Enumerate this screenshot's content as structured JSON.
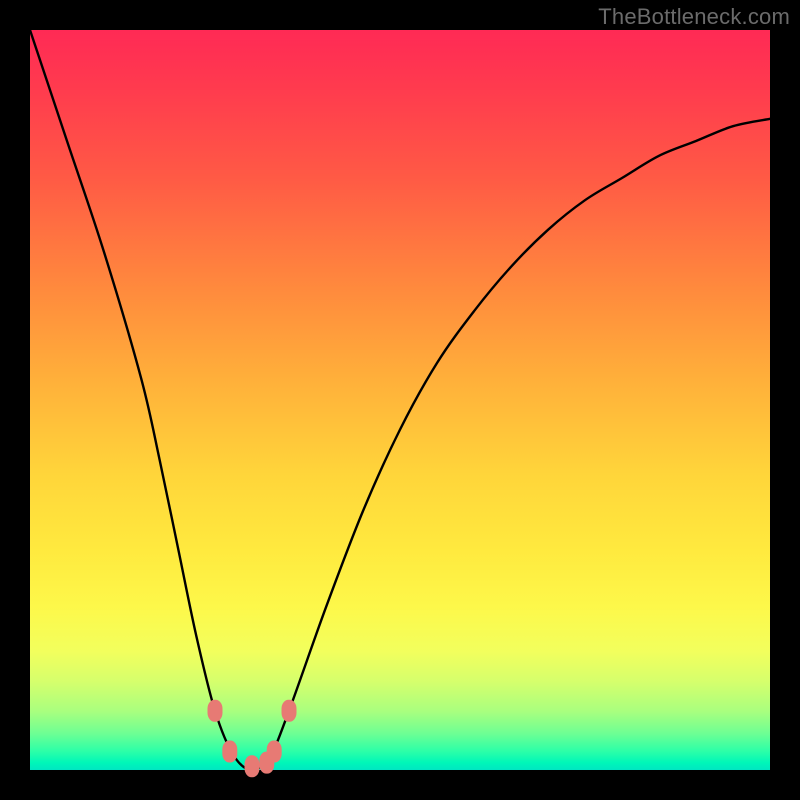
{
  "watermark": "TheBottleneck.com",
  "colors": {
    "frame": "#000000",
    "curve": "#000000",
    "marker": "#e77a74",
    "gradient_top": "#ff2a55",
    "gradient_bottom": "#00e6c2"
  },
  "chart_data": {
    "type": "line",
    "title": "",
    "xlabel": "",
    "ylabel": "",
    "xlim": [
      0,
      100
    ],
    "ylim": [
      0,
      100
    ],
    "series": [
      {
        "name": "bottleneck-curve",
        "x": [
          0,
          5,
          10,
          15,
          17.5,
          20,
          22.5,
          25,
          27.5,
          30,
          32.5,
          35,
          40,
          45,
          50,
          55,
          60,
          65,
          70,
          75,
          80,
          85,
          90,
          95,
          100
        ],
        "values": [
          100,
          85,
          70,
          53,
          42,
          30,
          18,
          8,
          2,
          0,
          2,
          8,
          22,
          35,
          46,
          55,
          62,
          68,
          73,
          77,
          80,
          83,
          85,
          87,
          88
        ]
      }
    ],
    "markers": [
      {
        "x": 25.0,
        "y": 8.0
      },
      {
        "x": 27.0,
        "y": 2.5
      },
      {
        "x": 30.0,
        "y": 0.5
      },
      {
        "x": 32.0,
        "y": 1.0
      },
      {
        "x": 33.0,
        "y": 2.5
      },
      {
        "x": 35.0,
        "y": 8.0
      }
    ]
  }
}
